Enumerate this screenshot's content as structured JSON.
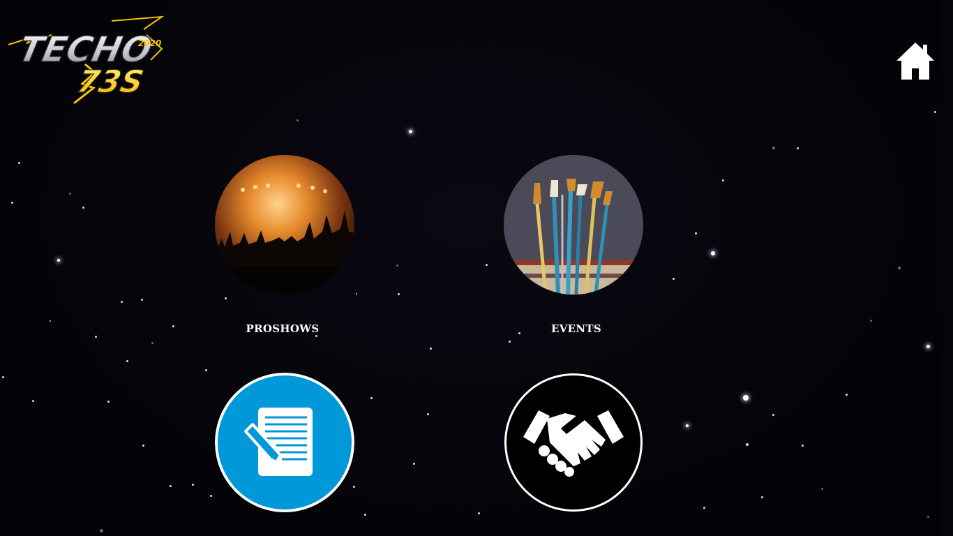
{
  "brand": {
    "logo_line1": "TECHO",
    "logo_line2": "73S",
    "logo_year": "2020"
  },
  "nav": {
    "home_icon": "home-icon"
  },
  "tiles": [
    {
      "label": "PROSHOWS",
      "icon": "concert-crowd-image"
    },
    {
      "label": "EVENTS",
      "icon": "paint-brushes-image"
    },
    {
      "label": "",
      "icon": "registration-form-icon",
      "color": "#0098d8"
    },
    {
      "label": "",
      "icon": "handshake-icon",
      "color": "#000000"
    }
  ],
  "colors": {
    "background": "#05040a",
    "accent_yellow": "#f5c400",
    "star": "#dcd6ff"
  }
}
